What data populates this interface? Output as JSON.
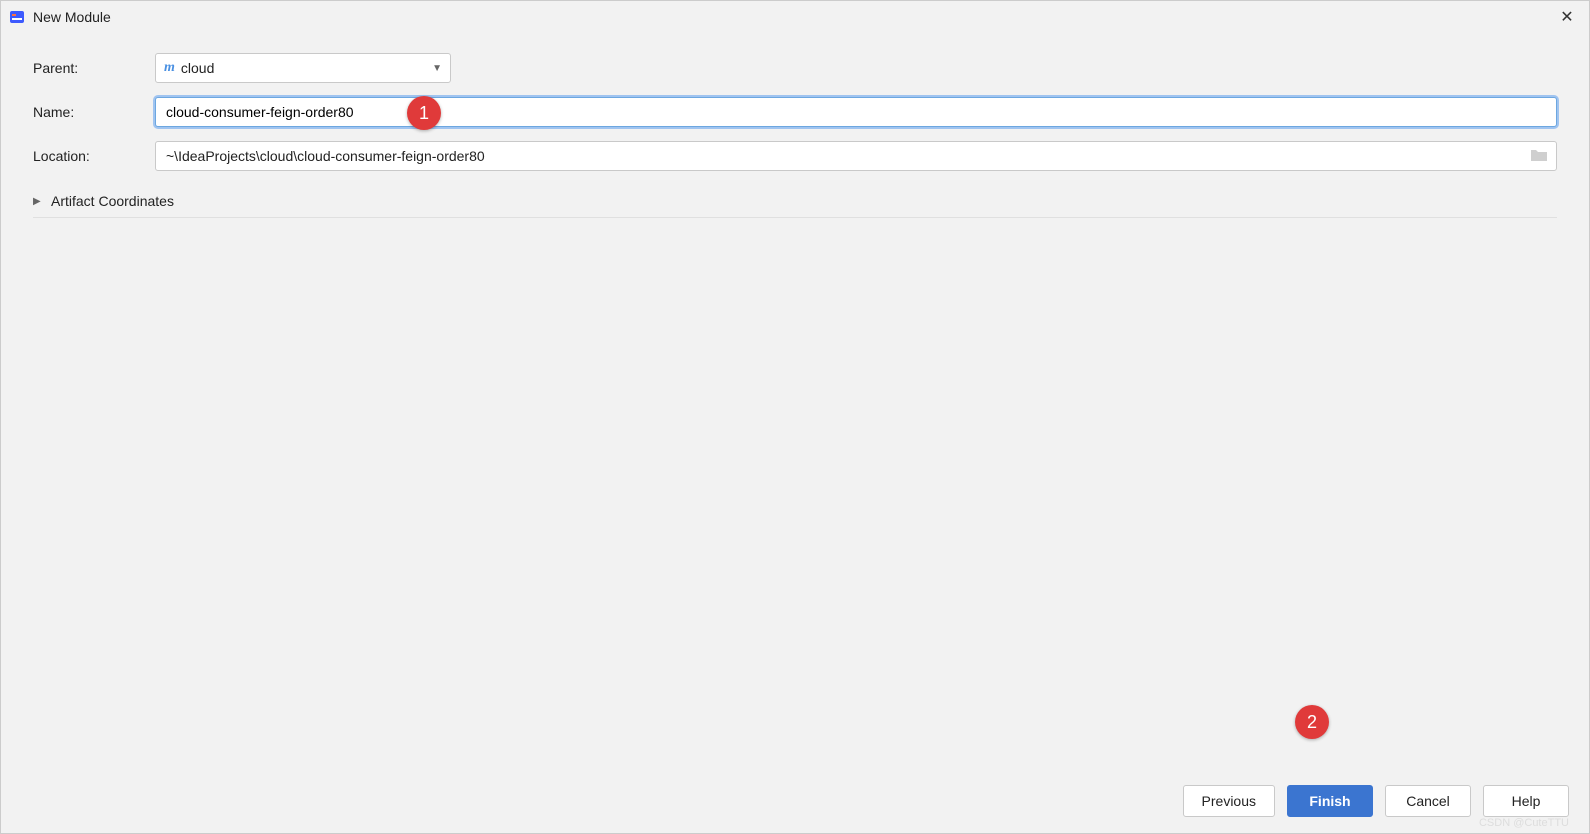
{
  "window": {
    "title": "New Module"
  },
  "form": {
    "parent_label": "Parent:",
    "parent_value": "cloud",
    "name_label": "Name:",
    "name_value": "cloud-consumer-feign-order80",
    "location_label": "Location:",
    "location_value": "~\\IdeaProjects\\cloud\\cloud-consumer-feign-order80",
    "artifact_label": "Artifact Coordinates"
  },
  "callouts": {
    "c1": "1",
    "c2": "2"
  },
  "buttons": {
    "previous": "Previous",
    "finish": "Finish",
    "cancel": "Cancel",
    "help": "Help"
  },
  "watermark": "CSDN @CuteTTU"
}
